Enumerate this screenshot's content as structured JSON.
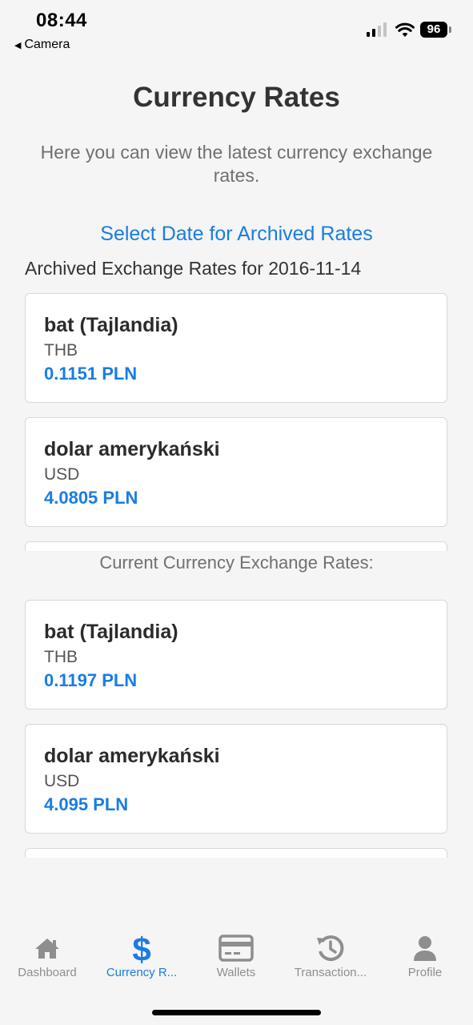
{
  "status_bar": {
    "time": "08:44",
    "back_label": "Camera",
    "battery": "96"
  },
  "header": {
    "title": "Currency Rates",
    "subtitle": "Here you can view the latest currency exchange rates."
  },
  "archive": {
    "link_label": "Select Date for Archived Rates",
    "heading": "Archived Exchange Rates for 2016-11-14",
    "items": [
      {
        "name": "bat (Tajlandia)",
        "code": "THB",
        "rate": "0.1151 PLN"
      },
      {
        "name": "dolar amerykański",
        "code": "USD",
        "rate": "4.0805 PLN"
      }
    ]
  },
  "current": {
    "heading": "Current Currency Exchange Rates:",
    "items": [
      {
        "name": "bat (Tajlandia)",
        "code": "THB",
        "rate": "0.1197 PLN"
      },
      {
        "name": "dolar amerykański",
        "code": "USD",
        "rate": "4.095 PLN"
      }
    ]
  },
  "tab_bar": {
    "active_color": "#1a7ce3",
    "inactive_color": "#8e8e8e",
    "tabs": [
      {
        "label": "Dashboard",
        "icon": "home-icon"
      },
      {
        "label": "Currency R...",
        "icon": "dollar-icon"
      },
      {
        "label": "Wallets",
        "icon": "credit-card-icon"
      },
      {
        "label": "Transaction...",
        "icon": "history-icon"
      },
      {
        "label": "Profile",
        "icon": "user-icon"
      }
    ]
  }
}
